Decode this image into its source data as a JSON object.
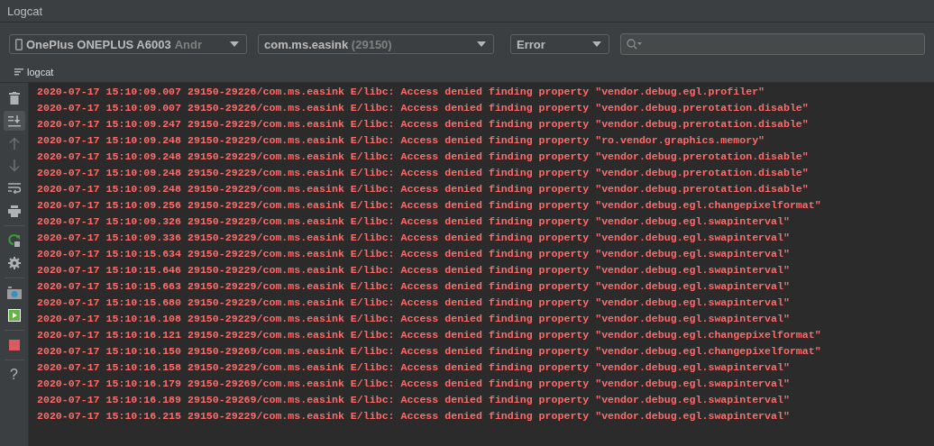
{
  "window": {
    "title": "Logcat"
  },
  "filters": {
    "device": {
      "name": "OnePlus ONEPLUS A6003",
      "detail": "Andr"
    },
    "process": {
      "package": "com.ms.",
      "package_bold": "easink",
      "pid": "(29150)"
    },
    "level": {
      "value": "Error"
    }
  },
  "tabs": [
    {
      "label": "logcat",
      "selected": true
    }
  ],
  "toolbar": [
    {
      "kind": "trash",
      "disabled": false,
      "selected": false
    },
    {
      "kind": "scroll-end",
      "disabled": false,
      "selected": true
    },
    {
      "kind": "up",
      "disabled": true,
      "selected": false
    },
    {
      "kind": "down",
      "disabled": true,
      "selected": false
    },
    {
      "kind": "wrap",
      "disabled": false,
      "selected": false
    },
    {
      "kind": "print",
      "disabled": false,
      "selected": false
    },
    {
      "kind": "separator"
    },
    {
      "kind": "restart",
      "disabled": false,
      "selected": false
    },
    {
      "kind": "settings",
      "disabled": false,
      "selected": false
    },
    {
      "kind": "separator"
    },
    {
      "kind": "camera",
      "disabled": false,
      "selected": false
    },
    {
      "kind": "record",
      "disabled": false,
      "selected": false
    },
    {
      "kind": "separator"
    },
    {
      "kind": "stop",
      "disabled": false,
      "selected": false
    },
    {
      "kind": "separator"
    },
    {
      "kind": "help",
      "label": "?",
      "disabled": false,
      "selected": false
    }
  ],
  "log": [
    "2020-07-17 15:10:09.007 29150-29226/com.ms.easink E/libc: Access denied finding property \"vendor.debug.egl.profiler\"",
    "2020-07-17 15:10:09.007 29150-29226/com.ms.easink E/libc: Access denied finding property \"vendor.debug.prerotation.disable\"",
    "2020-07-17 15:10:09.247 29150-29229/com.ms.easink E/libc: Access denied finding property \"vendor.debug.prerotation.disable\"",
    "2020-07-17 15:10:09.248 29150-29229/com.ms.easink E/libc: Access denied finding property \"ro.vendor.graphics.memory\"",
    "2020-07-17 15:10:09.248 29150-29229/com.ms.easink E/libc: Access denied finding property \"vendor.debug.prerotation.disable\"",
    "2020-07-17 15:10:09.248 29150-29229/com.ms.easink E/libc: Access denied finding property \"vendor.debug.prerotation.disable\"",
    "2020-07-17 15:10:09.248 29150-29229/com.ms.easink E/libc: Access denied finding property \"vendor.debug.prerotation.disable\"",
    "2020-07-17 15:10:09.256 29150-29229/com.ms.easink E/libc: Access denied finding property \"vendor.debug.egl.changepixelformat\"",
    "2020-07-17 15:10:09.326 29150-29229/com.ms.easink E/libc: Access denied finding property \"vendor.debug.egl.swapinterval\"",
    "2020-07-17 15:10:09.336 29150-29229/com.ms.easink E/libc: Access denied finding property \"vendor.debug.egl.swapinterval\"",
    "2020-07-17 15:10:15.634 29150-29229/com.ms.easink E/libc: Access denied finding property \"vendor.debug.egl.swapinterval\"",
    "2020-07-17 15:10:15.646 29150-29229/com.ms.easink E/libc: Access denied finding property \"vendor.debug.egl.swapinterval\"",
    "2020-07-17 15:10:15.663 29150-29229/com.ms.easink E/libc: Access denied finding property \"vendor.debug.egl.swapinterval\"",
    "2020-07-17 15:10:15.680 29150-29229/com.ms.easink E/libc: Access denied finding property \"vendor.debug.egl.swapinterval\"",
    "2020-07-17 15:10:16.108 29150-29229/com.ms.easink E/libc: Access denied finding property \"vendor.debug.egl.swapinterval\"",
    "2020-07-17 15:10:16.121 29150-29229/com.ms.easink E/libc: Access denied finding property \"vendor.debug.egl.changepixelformat\"",
    "2020-07-17 15:10:16.150 29150-29269/com.ms.easink E/libc: Access denied finding property \"vendor.debug.egl.changepixelformat\"",
    "2020-07-17 15:10:16.158 29150-29229/com.ms.easink E/libc: Access denied finding property \"vendor.debug.egl.swapinterval\"",
    "2020-07-17 15:10:16.179 29150-29269/com.ms.easink E/libc: Access denied finding property \"vendor.debug.egl.swapinterval\"",
    "2020-07-17 15:10:16.189 29150-29269/com.ms.easink E/libc: Access denied finding property \"vendor.debug.egl.swapinterval\"",
    "2020-07-17 15:10:16.215 29150-29229/com.ms.easink E/libc: Access denied finding property \"vendor.debug.egl.swapinterval\""
  ]
}
